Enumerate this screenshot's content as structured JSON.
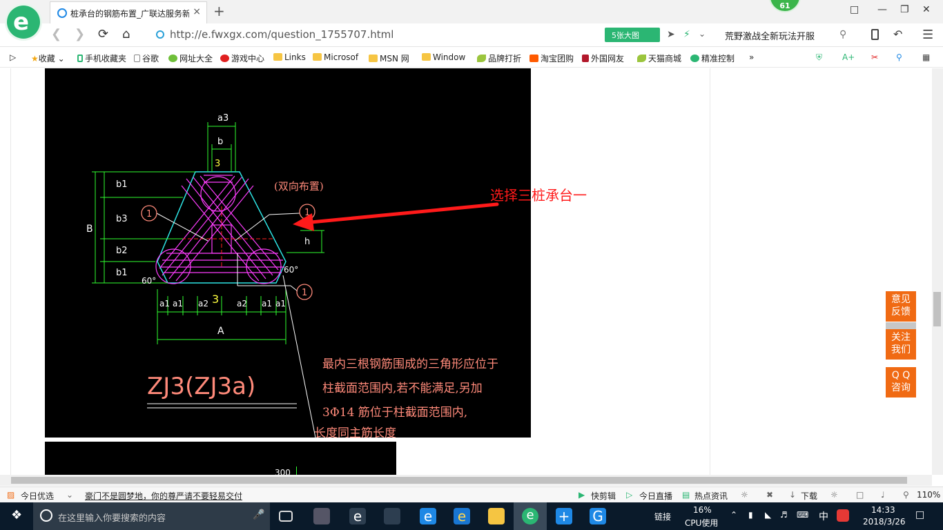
{
  "browser": {
    "tab_title": "桩承台的钢筋布置_广联达服务新",
    "tab_close": "×",
    "new_tab": "+",
    "badge_count": "61",
    "url": "http://e.fwxgx.com/question_1755707.html",
    "big_pic_label": "5张大图",
    "promo_text": "荒野激战全新玩法开服"
  },
  "bookmarks": [
    {
      "label": "收藏",
      "icon": "star-icon"
    },
    {
      "label": "手机收藏夹",
      "icon": "phone-icon"
    },
    {
      "label": "谷歌",
      "icon": "page-icon"
    },
    {
      "label": "网址大全",
      "icon": "web-icon"
    },
    {
      "label": "游戏中心",
      "icon": "game-icon"
    },
    {
      "label": "Links",
      "icon": "folder-icon"
    },
    {
      "label": "Microsof",
      "icon": "folder-icon"
    },
    {
      "label": "MSN 网",
      "icon": "folder-icon"
    },
    {
      "label": "Window",
      "icon": "folder-icon"
    },
    {
      "label": "品牌打折",
      "icon": "leaf-icon"
    },
    {
      "label": "淘宝团购",
      "icon": "taobao-icon"
    },
    {
      "label": "外国网友",
      "icon": "flag-icon"
    },
    {
      "label": "天猫商城",
      "icon": "leaf-icon"
    },
    {
      "label": "精准控制",
      "icon": "chat-icon"
    }
  ],
  "drawing": {
    "annotation": "选择三桩承台一",
    "title": "ZJ3(ZJ3a)",
    "bidirectional": "(双向布置)",
    "note_lines": [
      "最内三根钢筋围成的三角形应位于",
      "柱截面范围内,若不能满足,另加",
      "3Φ14 筋位于柱截面范围内,",
      "长度同主筋长度"
    ],
    "dim_A": "A",
    "dim_B": "B",
    "dim_h": "h",
    "dim_a3": "a3",
    "dim_b": "b",
    "dim_b1": "b1",
    "dim_b2": "b2",
    "dim_b3": "b3",
    "dim_a1": "a1",
    "dim_a2": "a2",
    "angle_60": "60°",
    "mark_1": "1",
    "num_3": "3",
    "second_dim": "300"
  },
  "sidebar_buttons": {
    "feedback": [
      "意见",
      "反馈"
    ],
    "follow": [
      "关注",
      "我们"
    ],
    "qq": [
      "Q Q",
      "咨询"
    ]
  },
  "statusbar": {
    "today_pick": "今日优选",
    "headline": "豪门不是圆梦地，你的尊严请不要轻易交付",
    "quick_cut": "快剪辑",
    "live": "今日直播",
    "news": "热点资讯",
    "download": "下载",
    "zoom": "110%"
  },
  "taskbar": {
    "search_placeholder": "在这里输入你要搜索的内容",
    "links_label": "链接",
    "cpu_percent": "16%",
    "cpu_label": "CPU使用",
    "ime": "中",
    "time": "14:33",
    "date": "2018/3/26"
  }
}
